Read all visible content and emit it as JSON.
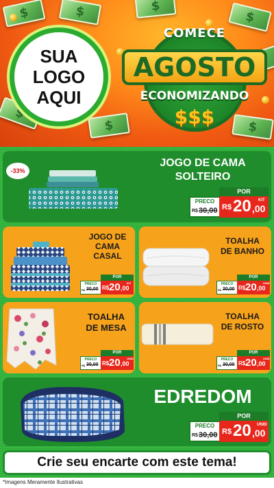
{
  "logo": {
    "line1": "SUA",
    "line2": "LOGO",
    "line3": "AQUI"
  },
  "campaign": {
    "comece": "COMECE",
    "title": "AGOSTO",
    "subtitle": "ECONOMIZANDO",
    "dollars": "$$$"
  },
  "price_labels": {
    "preco": "PRECO",
    "por": "POR",
    "currency": "R$"
  },
  "products": [
    {
      "name_line1": "JOGO DE CAMA",
      "name_line2": "SOLTEIRO",
      "badge": "-33%",
      "old_currency": "R$",
      "old_price": "30,00",
      "price_int": "20",
      "price_dec": ",00",
      "unit": "KIT"
    },
    {
      "name_line1": "JOGO DE",
      "name_line2": "CAMA",
      "name_line3": "CASAL",
      "old_currency": "R$",
      "old_price": "30,00",
      "price_int": "20",
      "price_dec": ",00",
      "unit": "KIT"
    },
    {
      "name_line1": "TOALHA",
      "name_line2": "DE BANHO",
      "old_currency": "R$",
      "old_price": "30,00",
      "price_int": "20",
      "price_dec": ",00",
      "unit": "UNID"
    },
    {
      "name_line1": "TOALHA",
      "name_line2": "DE MESA",
      "old_currency": "R$",
      "old_price": "30,00",
      "price_int": "20",
      "price_dec": ",00",
      "unit": "UNID"
    },
    {
      "name_line1": "TOALHA",
      "name_line2": "DE ROSTO",
      "old_currency": "R$",
      "old_price": "30,00",
      "price_int": "20",
      "price_dec": ",00",
      "unit": "UNID"
    },
    {
      "name_line1": "EDREDOM",
      "old_currency": "R$",
      "old_price": "30,00",
      "price_int": "20",
      "price_dec": ",00",
      "unit": "UNID"
    }
  ],
  "banner": "Crie seu encarte com este tema!",
  "footnote": "*Imagens Meramente Ilustrativas",
  "colors": {
    "green": "#1f8d2c",
    "orange": "#f7a21b",
    "red": "#e8271c",
    "header_orange": "#f05a12"
  }
}
